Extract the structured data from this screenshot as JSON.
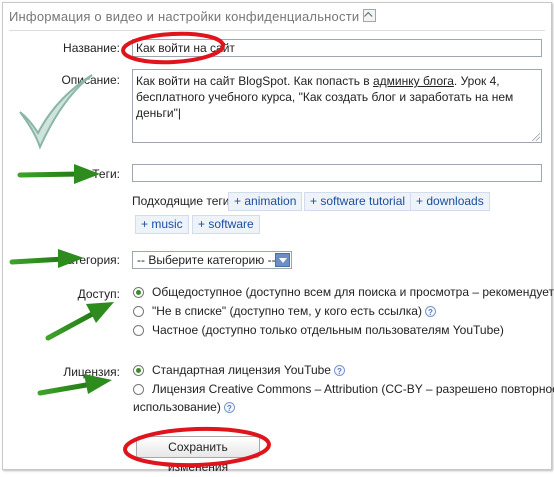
{
  "header": {
    "title": "Информация о видео и настройки конфиденциальности"
  },
  "form": {
    "title_label": "Название:",
    "title_value": "Как войти на сайт",
    "description_label": "Описание:",
    "description_part1": "Как войти на сайт BlogSpot. Как попасть в ",
    "description_link": "админку блога",
    "description_part2": ". Урок 4, бесплатного учебного курса, \"Как создать блог и заработать на нем деньги\"",
    "tags_label": "Теги:",
    "tags_value": "",
    "suggested_tags_label": "Подходящие теги",
    "suggested_tags": [
      "+ animation",
      "+ software tutorial",
      "+ downloads",
      "+ music",
      "+ software"
    ],
    "category_label": "Категория:",
    "category_selected": "-- Выберите категорию --",
    "access_label": "Доступ:",
    "access_options": [
      "Общедоступное (доступно всем для поиска и просмотра – рекомендуется)",
      "\"Не в списке\" (доступно тем, у кого есть ссылка)",
      "Частное (доступно только отдельным пользователям YouTube)"
    ],
    "access_selected_index": 0,
    "license_label": "Лицензия:",
    "license_options": [
      "Стандартная лицензия YouTube",
      "Лицензия Creative Commons – Attribution (CC-BY – разрешено повторное",
      "использование)"
    ],
    "license_selected_index": 0,
    "save_button": "Сохранить изменения",
    "help_glyph": "?"
  },
  "colors": {
    "arrow": "#2e8b1e",
    "highlight": "#e0141c",
    "check": "#8ab6a6",
    "chip_text": "#1a4fa0"
  }
}
